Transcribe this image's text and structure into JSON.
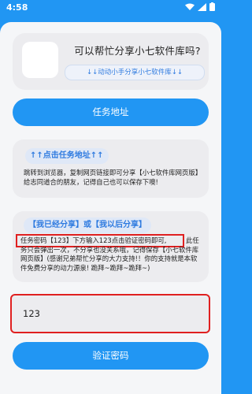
{
  "status_bar": {
    "time": "4:58"
  },
  "header": {
    "title": "可以帮忙分享小七软件库吗?",
    "subtitle": "↓↓动动小手分享小七软件库↓↓"
  },
  "task_button": {
    "label": "任务地址"
  },
  "card1": {
    "chip": "↑↑点击任务地址↑↑",
    "text": "跳转到浏览器，复制网页链接即可分享【小七软件库网页版】给志同道合的朋友，记得自己也可以保存下噢!"
  },
  "card2": {
    "chip": "【我已经分享】或【我以后分享】",
    "text_highlight": "任务密码【123】下方输入123点击验证密码即可,",
    "text_rest": "此任务只会弹出一次，不分享也没关系哦，记得保存【小七软件库网页版】(感谢兄弟帮忙分享的大力支持!！你的支持就是本软件免费分享的动力源泉! 跪拜~跪拜~跪拜~)"
  },
  "code_input": {
    "value": "123"
  },
  "verify_button": {
    "label": "验证密码"
  },
  "colors": {
    "accent": "#2196f3",
    "highlight_border": "#e02020"
  }
}
